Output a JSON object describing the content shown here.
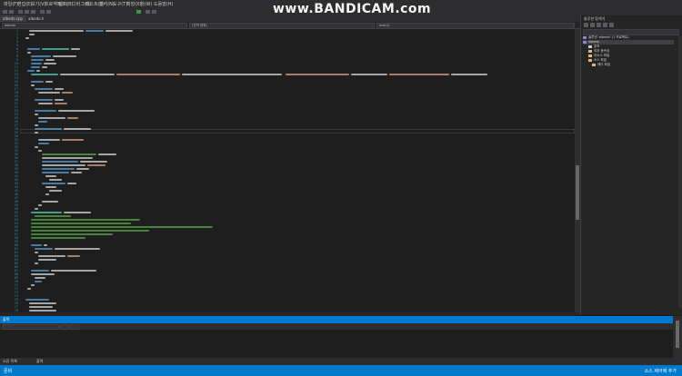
{
  "watermark": "www.BANDICAM.com",
  "menu": [
    "파일(F)",
    "편집(E)",
    "보기(V)",
    "프로젝트(P)",
    "빌드(B)",
    "디버그(D)",
    "테스트(S)",
    "분석(N)",
    "도구(T)",
    "확장(X)",
    "창(W)",
    "도움말(H)"
  ],
  "tabs": [
    "albedo.cpp",
    "albedo.h"
  ],
  "nav": [
    "albedo",
    "(전역 범위)",
    "main()"
  ],
  "solution_explorer": {
    "title": "솔루션 탐색기",
    "items": [
      "솔루션 'albedo' (1 프로젝트)",
      "albedo",
      "참조",
      "외부 종속성",
      "리소스 파일",
      "소스 파일",
      "헤더 파일"
    ]
  },
  "output": {
    "title": "출력",
    "tabs": [
      "오류 목록",
      "출력"
    ]
  },
  "status": {
    "left": "준비",
    "right": "소스 제어에 추가"
  },
  "colors": {
    "accent": "#007acc",
    "keyword": "#569cd6",
    "comment": "#57a64a",
    "string": "#d69d85",
    "type": "#4ec9b0",
    "text": "#d4d4d4",
    "linenumber": "#2b91af"
  }
}
